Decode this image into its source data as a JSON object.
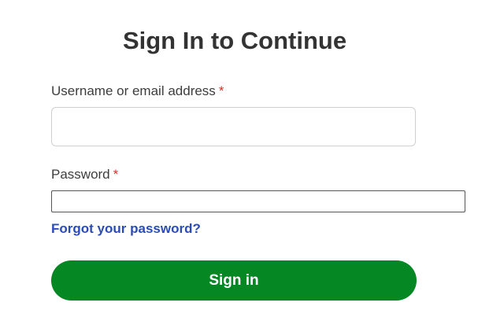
{
  "page": {
    "title": "Sign In to Continue"
  },
  "form": {
    "username": {
      "label": "Username or email address",
      "required_marker": "*",
      "value": "",
      "placeholder": ""
    },
    "password": {
      "label": "Password",
      "required_marker": "*",
      "value": "",
      "placeholder": ""
    },
    "forgot_link": "Forgot your password?",
    "submit_label": "Sign in"
  },
  "colors": {
    "primary_button": "#058724",
    "link": "#2a4bb8",
    "required": "#d0312d"
  }
}
